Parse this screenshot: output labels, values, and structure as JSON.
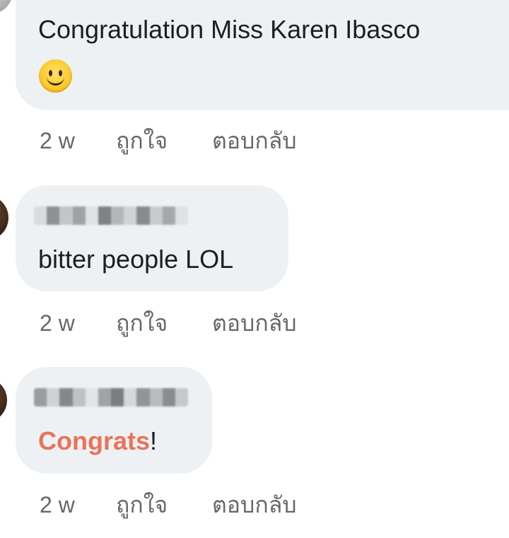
{
  "comments": [
    {
      "text": "Congratulation Miss Karen Ibasco",
      "emoji": "slightly-smiling-face",
      "time": "2 w",
      "like_label": "ถูกใจ",
      "reply_label": "ตอบกลับ"
    },
    {
      "author_blurred": true,
      "text": "bitter people LOL",
      "time": "2 w",
      "like_label": "ถูกใจ",
      "reply_label": "ตอบกลับ"
    },
    {
      "author_blurred": true,
      "text_highlight": "Congrats",
      "text_rest": "!",
      "time": "2 w",
      "like_label": "ถูกใจ",
      "reply_label": "ตอบกลับ"
    }
  ],
  "colors": {
    "bubble": "#eef1f3",
    "meta_text": "#65676b",
    "highlight": "#e8735a"
  }
}
